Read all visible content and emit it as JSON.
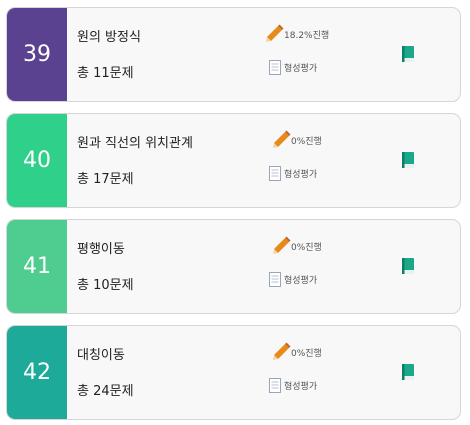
{
  "cards": [
    {
      "number": "39",
      "title": "원의 방정식",
      "count": "총 11문제",
      "progress": "18.2%진행",
      "eval": "형성평가",
      "color": "#5b4290"
    },
    {
      "number": "40",
      "title": "원과 직선의 위치관계",
      "count": "총 17문제",
      "progress": "0%진행",
      "eval": "형성평가",
      "color": "#2ed08a"
    },
    {
      "number": "41",
      "title": "평행이동",
      "count": "총 10문제",
      "progress": "0%진행",
      "eval": "형성평가",
      "color": "#4fcc8f"
    },
    {
      "number": "42",
      "title": "대칭이동",
      "count": "총 24문제",
      "progress": "0%진행",
      "eval": "형성평가",
      "color": "#1eaa99"
    }
  ],
  "icons": {
    "progress": "pencil-icon",
    "eval": "document-icon",
    "book": "book-icon"
  },
  "colors": {
    "book": "#1aa889",
    "book_dark": "#0f7e66",
    "pencil": "#e88a1a"
  }
}
